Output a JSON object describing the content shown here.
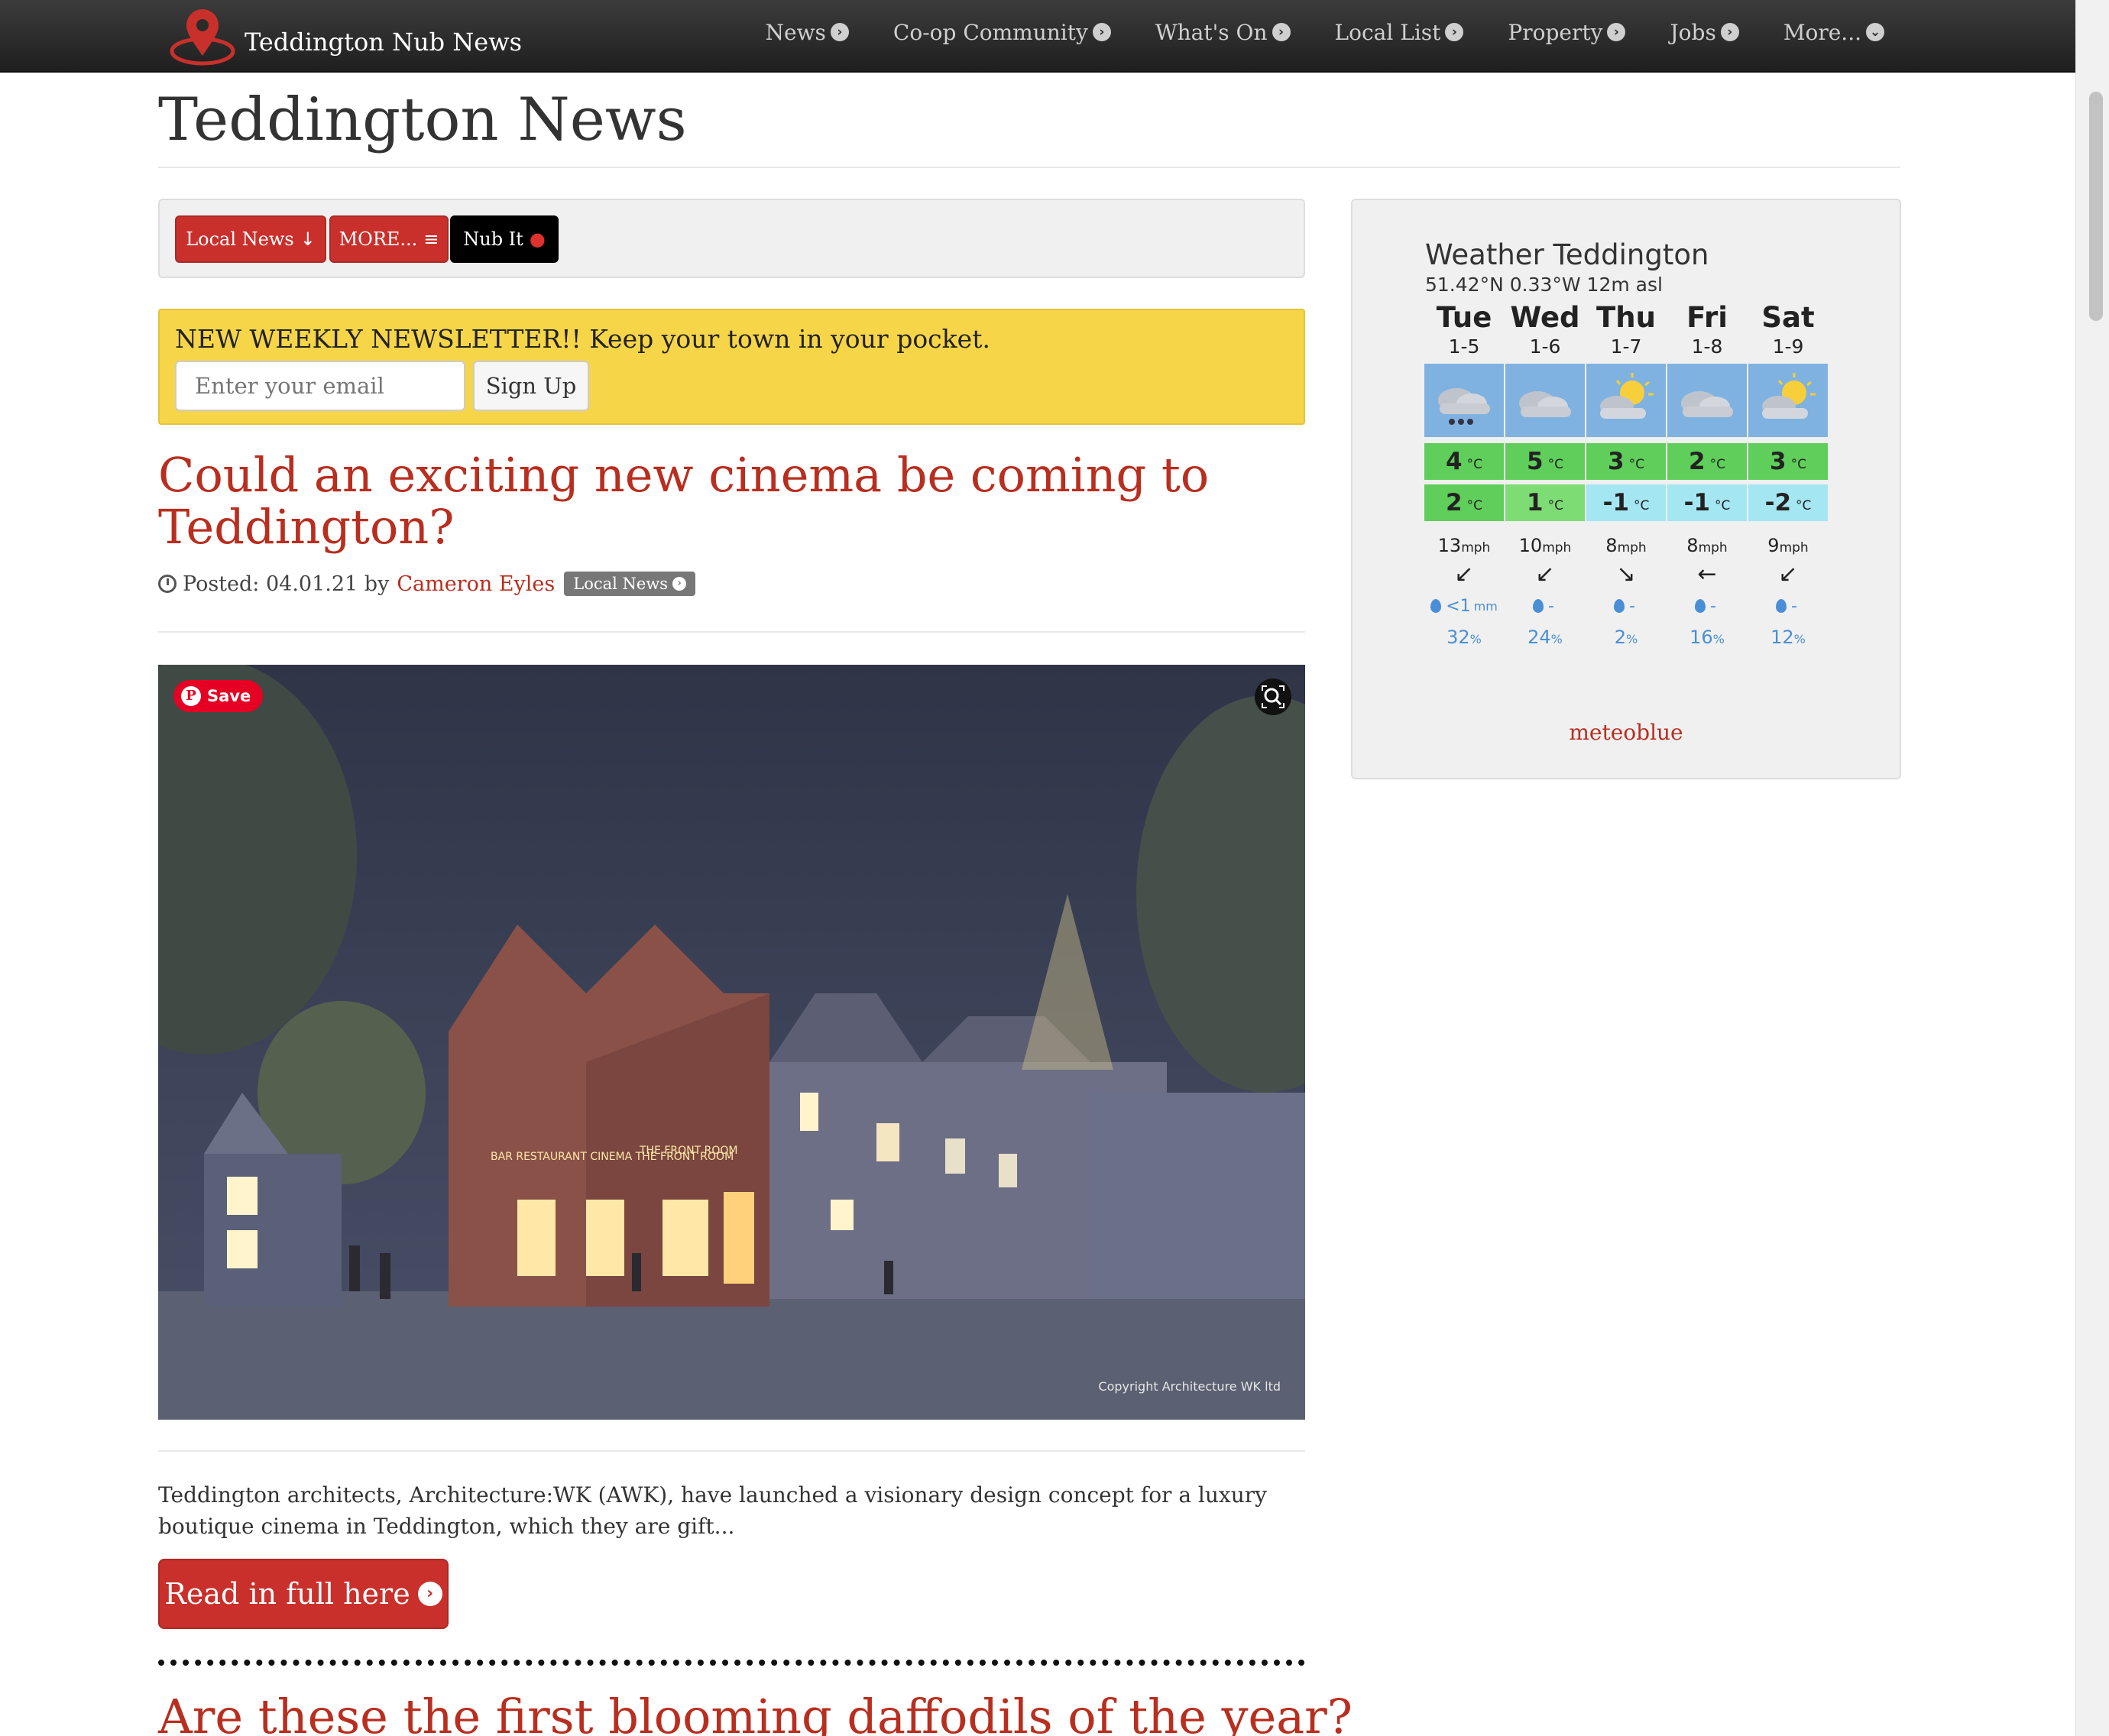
{
  "site": {
    "brand": "Teddington Nub News"
  },
  "nav": [
    {
      "label": "News"
    },
    {
      "label": "Co-op Community"
    },
    {
      "label": "What's On"
    },
    {
      "label": "Local List"
    },
    {
      "label": "Property"
    },
    {
      "label": "Jobs"
    },
    {
      "label": "More..."
    }
  ],
  "page": {
    "title": "Teddington News"
  },
  "buttons": {
    "local_news": "Local News",
    "more": "MORE...",
    "nub_it": "Nub It"
  },
  "newsletter": {
    "text": "NEW WEEKLY NEWSLETTER!! Keep your town in your pocket.",
    "placeholder": "Enter your email",
    "signup": "Sign Up"
  },
  "article": {
    "title": "Could an exciting new cinema be coming to Teddington?",
    "posted_prefix": "Posted: 04.01.21 by",
    "author": "Cameron Eyles",
    "category": "Local News",
    "image_save": "Save",
    "image_copyright": "Copyright Architecture WK ltd",
    "image_sign_1": "BAR RESTAURANT CINEMA  THE FRONT ROOM",
    "image_sign_2": "THE FRONT ROOM",
    "excerpt": "Teddington architects, Architecture:WK (AWK), have launched a visionary design concept for a luxury boutique cinema in Teddington, which they are gift...",
    "read_more": "Read in full here"
  },
  "next_article": {
    "title": "Are these the first blooming daffodils of the year?"
  },
  "weather": {
    "title": "Weather Teddington",
    "coords": "51.42°N 0.33°W 12m asl",
    "temp_unit": "°C",
    "wind_unit": "mph",
    "prob_unit": "%",
    "credit": "meteoblue",
    "days": [
      {
        "day": "Tue",
        "date": "1-5",
        "icon": "cloud-snow-icon",
        "max": "4",
        "min": "2",
        "wind": "13",
        "wind_dir": "↙",
        "precip": "<1",
        "precip_unit": "mm",
        "prob": "32",
        "max_color": "#5fce5a",
        "min_color": "#5fce5a"
      },
      {
        "day": "Wed",
        "date": "1-6",
        "icon": "cloud-icon",
        "max": "5",
        "min": "1",
        "wind": "10",
        "wind_dir": "↙",
        "precip": "-",
        "precip_unit": "",
        "prob": "24",
        "max_color": "#5fce5a",
        "min_color": "#7edc75"
      },
      {
        "day": "Thu",
        "date": "1-7",
        "icon": "sun-cloud-icon",
        "max": "3",
        "min": "-1",
        "wind": "8",
        "wind_dir": "↘",
        "precip": "-",
        "precip_unit": "",
        "prob": "2",
        "max_color": "#5fce5a",
        "min_color": "#a4e6f2"
      },
      {
        "day": "Fri",
        "date": "1-8",
        "icon": "cloud-icon",
        "max": "2",
        "min": "-1",
        "wind": "8",
        "wind_dir": "←",
        "precip": "-",
        "precip_unit": "",
        "prob": "16",
        "max_color": "#5fce5a",
        "min_color": "#a4e6f2"
      },
      {
        "day": "Sat",
        "date": "1-9",
        "icon": "sun-cloud-icon",
        "max": "3",
        "min": "-2",
        "wind": "9",
        "wind_dir": "↙",
        "precip": "-",
        "precip_unit": "",
        "prob": "12",
        "max_color": "#5fce5a",
        "min_color": "#a4e6f2"
      }
    ]
  }
}
